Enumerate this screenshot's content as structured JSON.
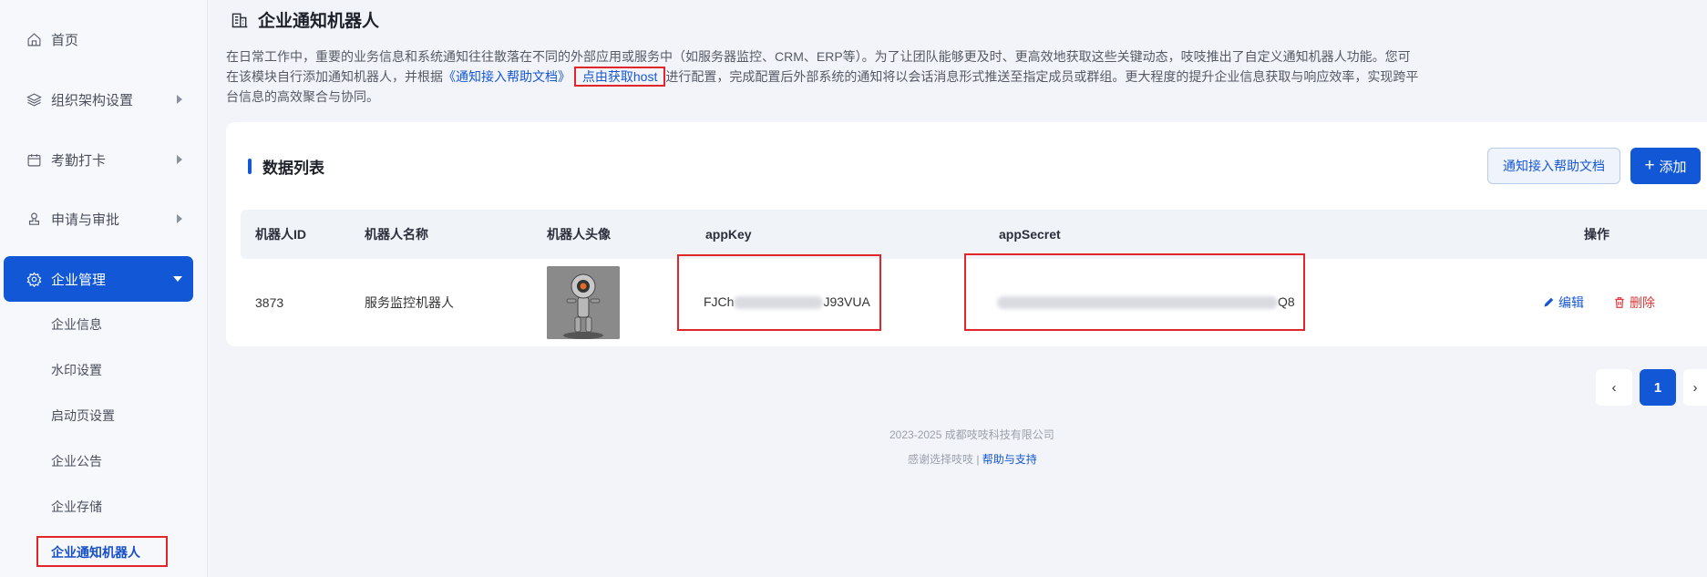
{
  "sidebar": {
    "items": [
      {
        "label": "首页",
        "icon": "home-icon"
      },
      {
        "label": "组织架构设置",
        "icon": "layers-icon"
      },
      {
        "label": "考勤打卡",
        "icon": "calendar-icon"
      },
      {
        "label": "申请与审批",
        "icon": "user-stamp-icon"
      },
      {
        "label": "企业管理",
        "icon": "gear-icon"
      }
    ],
    "sub_items": [
      "企业信息",
      "水印设置",
      "启动页设置",
      "企业公告",
      "企业存储",
      "企业通知机器人"
    ]
  },
  "header": {
    "title": "企业通知机器人",
    "desc_part1": "在日常工作中，重要的业务信息和系统通知往往散落在不同的外部应用或服务中（如服务器监控、CRM、ERP等）。为了让团队能够更及时、更高效地获取这些关键动态，吱吱推出了自定义通知机器人功能。您可",
    "desc_part2": "在该模块自行添加通知机器人，并根据",
    "desc_link1": "《通知接入帮助文档》",
    "desc_link2": "点由获取host",
    "desc_part3": "进行配置，完成配置后外部系统的通知将以会话消息形式推送至指定成员或群组。更大程度的提升企业信息获取与响应效率，实现跨平",
    "desc_part4": "台信息的高效聚合与协同。"
  },
  "card": {
    "title": "数据列表",
    "help_button": "通知接入帮助文档",
    "add_button": "添加",
    "columns": [
      "机器人ID",
      "机器人名称",
      "机器人头像",
      "appKey",
      "appSecret",
      "操作"
    ],
    "rows": [
      {
        "id": "3873",
        "name": "服务监控机器人",
        "app_key_prefix": "FJCh",
        "app_key_suffix": "J93VUA",
        "app_secret_suffix": "Q8",
        "edit": "编辑",
        "delete": "删除"
      }
    ]
  },
  "pagination": {
    "prev": "‹",
    "current": "1",
    "next": "›"
  },
  "footer": {
    "copyright": "2023-2025 成都吱吱科技有限公司",
    "thanks": "感谢选择吱吱 |",
    "help_link": "帮助与支持"
  },
  "colors": {
    "primary": "#1257d6",
    "highlight": "#e0262a",
    "danger": "#e0353a"
  }
}
